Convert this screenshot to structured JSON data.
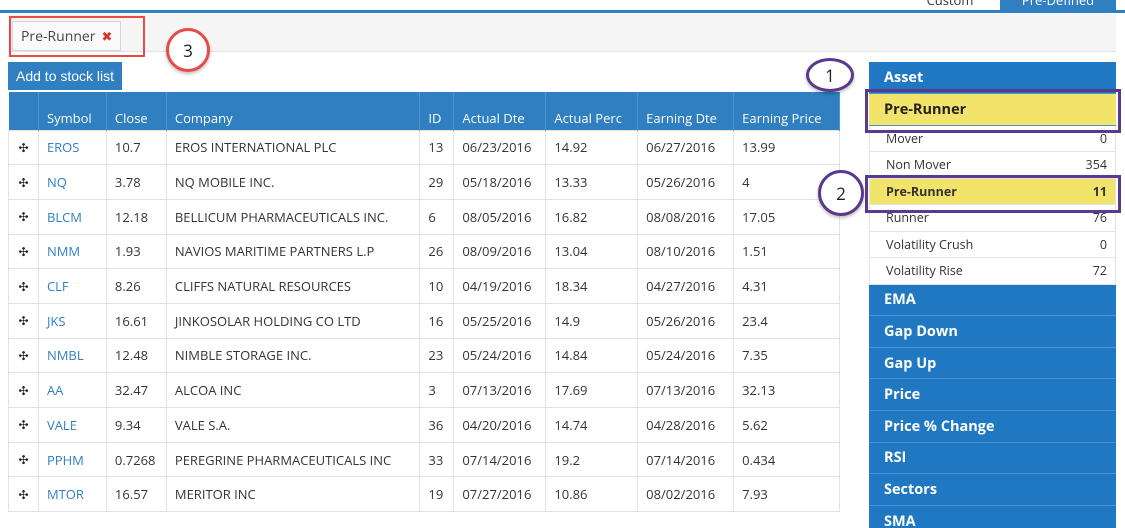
{
  "tabs": {
    "custom": "Custom",
    "predefined": "Pre-Defined"
  },
  "filter": {
    "tag_label": "Pre-Runner",
    "remove_icon": "✖"
  },
  "add_button_label": "Add to stock list",
  "table": {
    "headers": [
      "",
      "Symbol",
      "Close",
      "Company",
      "ID",
      "Actual Dte",
      "Actual Perc",
      "Earning Dte",
      "Earning Price"
    ],
    "rows": [
      [
        "EROS",
        "10.7",
        "EROS INTERNATIONAL PLC",
        "13",
        "06/23/2016",
        "14.92",
        "06/27/2016",
        "13.99"
      ],
      [
        "NQ",
        "3.78",
        "NQ MOBILE INC.",
        "29",
        "05/18/2016",
        "13.33",
        "05/26/2016",
        "4"
      ],
      [
        "BLCM",
        "12.18",
        "BELLICUM PHARMACEUTICALS INC.",
        "6",
        "08/05/2016",
        "16.82",
        "08/08/2016",
        "17.05"
      ],
      [
        "NMM",
        "1.93",
        "NAVIOS MARITIME PARTNERS L.P",
        "26",
        "08/09/2016",
        "13.04",
        "08/10/2016",
        "1.51"
      ],
      [
        "CLF",
        "8.26",
        "CLIFFS NATURAL RESOURCES",
        "10",
        "04/19/2016",
        "18.34",
        "04/27/2016",
        "4.31"
      ],
      [
        "JKS",
        "16.61",
        "JINKOSOLAR HOLDING CO LTD",
        "16",
        "05/25/2016",
        "14.9",
        "05/26/2016",
        "23.4"
      ],
      [
        "NMBL",
        "12.48",
        "NIMBLE STORAGE INC.",
        "23",
        "05/24/2016",
        "14.84",
        "05/24/2016",
        "7.35"
      ],
      [
        "AA",
        "32.47",
        "ALCOA INC",
        "3",
        "07/13/2016",
        "17.69",
        "07/13/2016",
        "32.13"
      ],
      [
        "VALE",
        "9.34",
        "VALE S.A.",
        "36",
        "04/20/2016",
        "14.74",
        "04/28/2016",
        "5.62"
      ],
      [
        "PPHM",
        "0.7268",
        "PEREGRINE PHARMACEUTICALS INC",
        "33",
        "07/14/2016",
        "19.2",
        "07/14/2016",
        "0.434"
      ],
      [
        "MTOR",
        "16.57",
        "MERITOR INC",
        "19",
        "07/27/2016",
        "10.86",
        "08/02/2016",
        "7.93"
      ]
    ],
    "row_icon": "move-icon"
  },
  "panel": {
    "asset_label": "Asset",
    "selected_category": "Pre-Runner",
    "subitems": [
      {
        "label": "Mover",
        "count": "0"
      },
      {
        "label": "Non Mover",
        "count": "354"
      },
      {
        "label": "Pre-Runner",
        "count": "11",
        "selected": true
      },
      {
        "label": "Runner",
        "count": "76"
      },
      {
        "label": "Volatility Crush",
        "count": "0"
      },
      {
        "label": "Volatility Rise",
        "count": "72"
      }
    ],
    "categories": [
      "EMA",
      "Gap Down",
      "Gap Up",
      "Price",
      "Price % Change",
      "RSI",
      "Sectors",
      "SMA"
    ]
  },
  "callouts": {
    "one": "1",
    "two": "2",
    "three": "3"
  },
  "colors": {
    "primary": "#2f7fc1",
    "highlight": "#f2e36a",
    "annotation_red": "#e84a4a",
    "annotation_purple": "#5b3a8e"
  }
}
